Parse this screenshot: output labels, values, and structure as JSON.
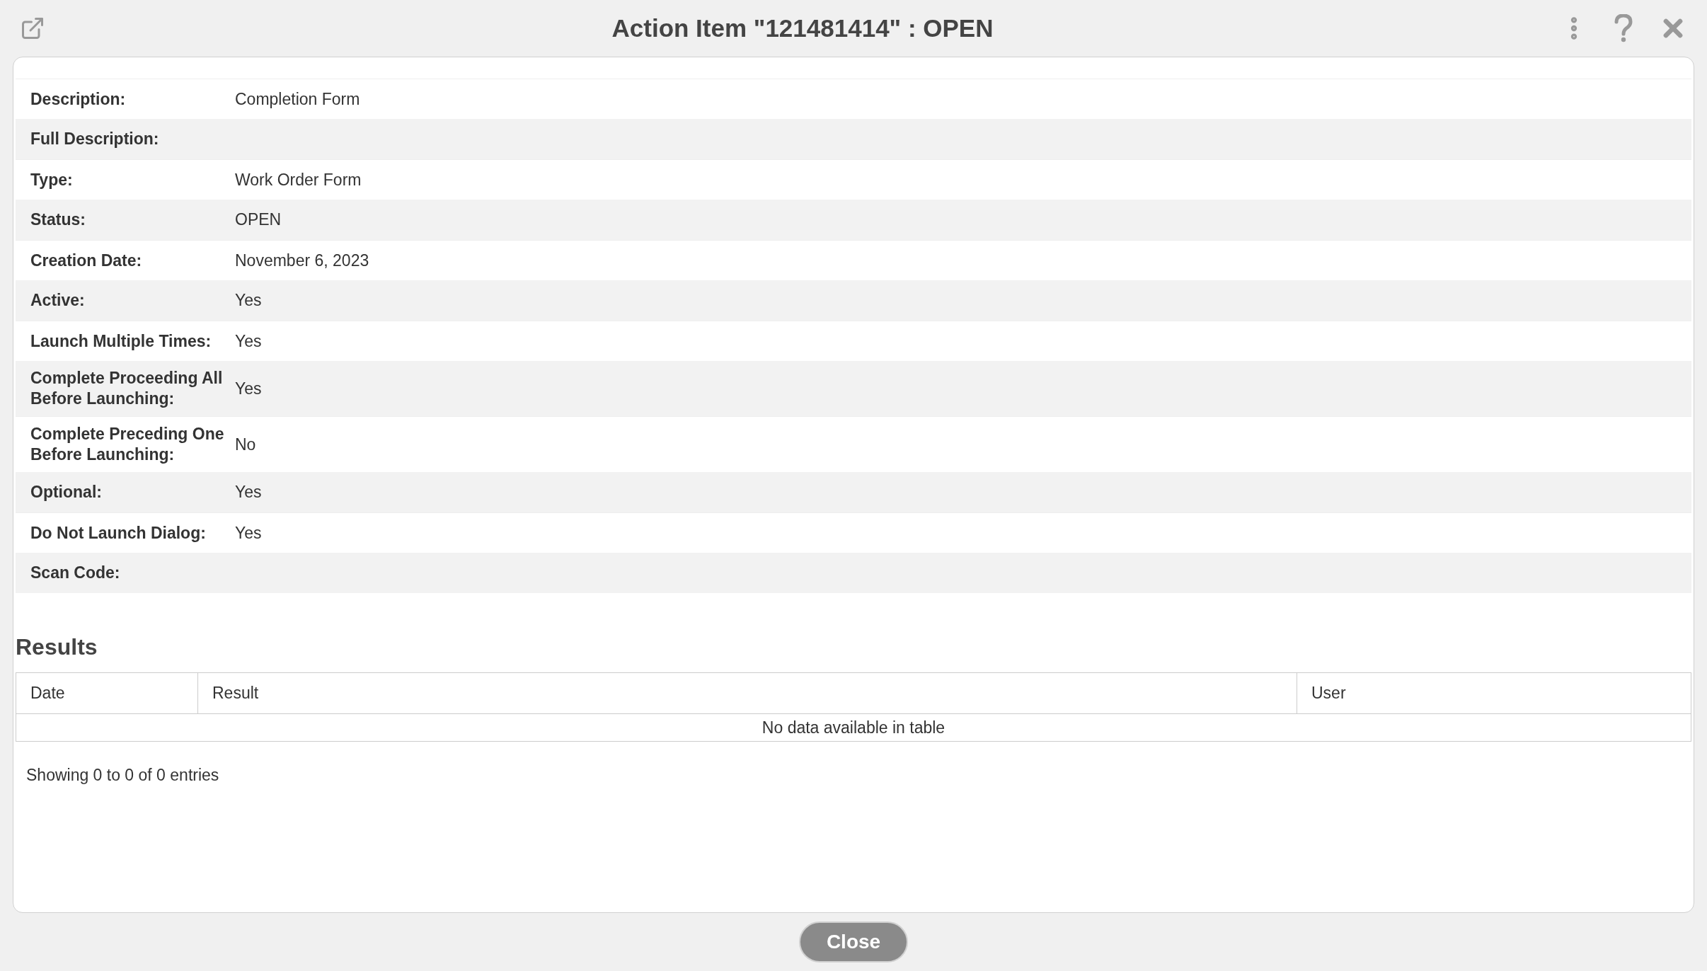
{
  "window": {
    "title": "Action Item \"121481414\" : OPEN"
  },
  "details": [
    {
      "label": "Description:",
      "value": "Completion Form"
    },
    {
      "label": "Full Description:"
    },
    {
      "label": "Type:",
      "value": "Work Order Form"
    },
    {
      "label": "Status:",
      "value": "OPEN"
    },
    {
      "label": "Creation Date:",
      "value": "November 6, 2023"
    },
    {
      "label": "Active:",
      "value": "Yes"
    },
    {
      "label": "Launch Multiple Times:",
      "value": "Yes"
    },
    {
      "label": "Complete Proceeding All Before Launching:",
      "value": "Yes"
    },
    {
      "label": "Complete Preceding One Before Launching:",
      "value": "No"
    },
    {
      "label": "Optional:",
      "value": "Yes"
    },
    {
      "label": "Do Not Launch Dialog:",
      "value": "Yes"
    },
    {
      "label": "Scan Code:"
    }
  ],
  "results": {
    "title": "Results",
    "columns": [
      "Date",
      "Result",
      "User"
    ],
    "empty_message": "No data available in table",
    "info": "Showing 0 to 0 of 0 entries"
  },
  "buttons": [
    "Close"
  ]
}
